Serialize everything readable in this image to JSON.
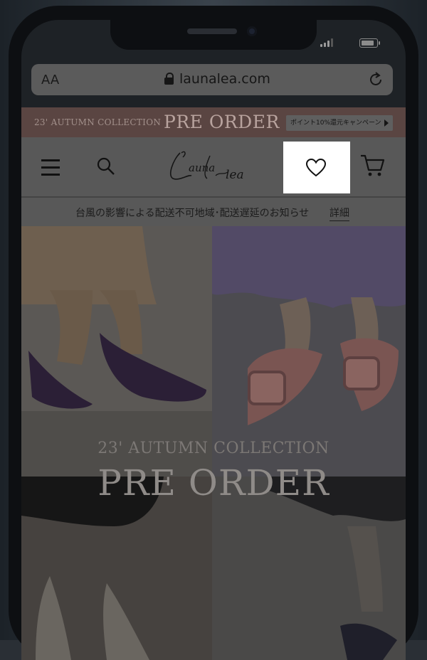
{
  "browser": {
    "text_size_label": "AA",
    "domain": "launalea.com"
  },
  "banner": {
    "collection": "23' AUTUMN COLLECTION",
    "title": "PRE ORDER",
    "campaign_button": "ポイント10%還元キャンペーン"
  },
  "header": {
    "logo_text": "Launa lea"
  },
  "notice": {
    "text": "台風の影響による配送不可地域･配送遅延のお知らせ",
    "link": "詳細"
  },
  "hero": {
    "collection": "23' AUTUMN COLLECTION",
    "title": "PRE ORDER"
  },
  "colors": {
    "banner_bg": "#5a4542",
    "highlight": "#ffffff"
  }
}
